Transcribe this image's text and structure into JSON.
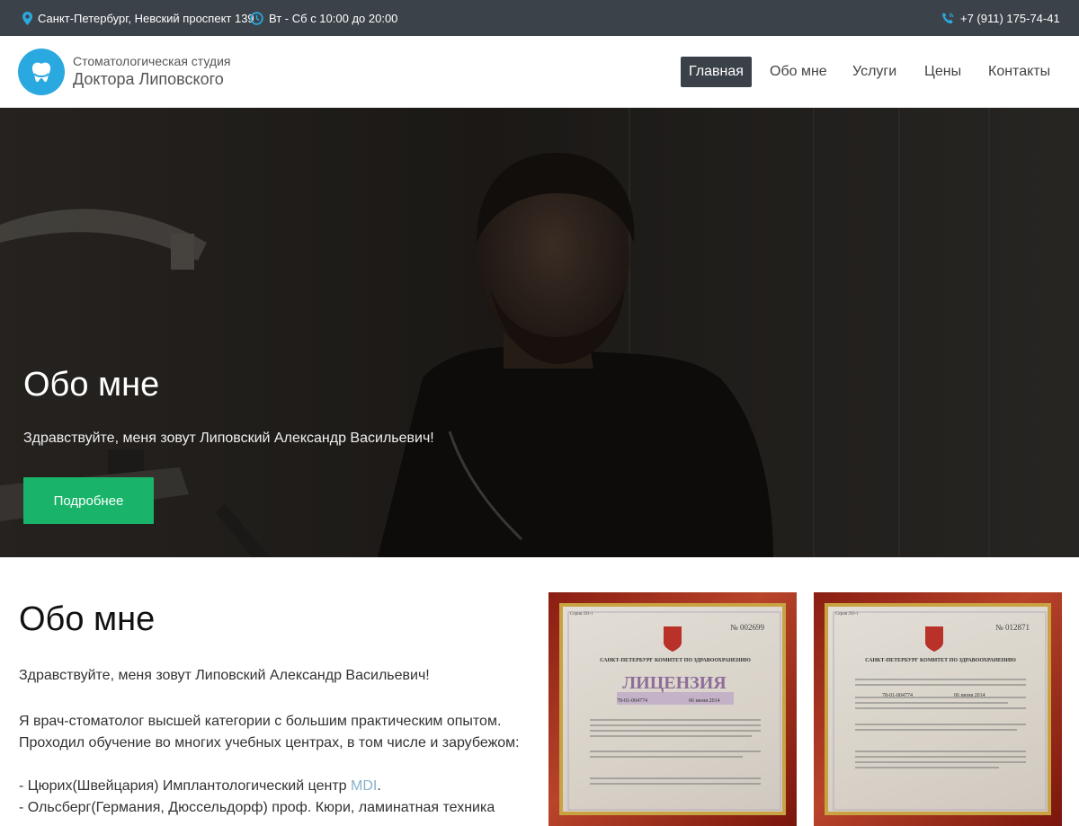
{
  "topbar": {
    "address": "Санкт-Петербург, Невский проспект 139",
    "hours": "Вт - Сб с 10:00 до 20:00",
    "phone": "+7 (911) 175-74-41"
  },
  "brand": {
    "line1": "Стоматологическая студия",
    "line2": "Доктора Липовского"
  },
  "nav": {
    "items": [
      {
        "label": "Главная",
        "active": true
      },
      {
        "label": "Обо мне"
      },
      {
        "label": "Услуги"
      },
      {
        "label": "Цены"
      },
      {
        "label": "Контакты"
      }
    ]
  },
  "hero": {
    "title": "Обо мне",
    "subtitle": "Здравствуйте, меня зовут Липовский Александр Васильевич!",
    "button": "Подробнее"
  },
  "about": {
    "title": "Обо мне",
    "greeting": "Здравствуйте, меня зовут Липовский Александр Васильевич!",
    "p1": "Я врач-стоматолог высшей категории с большим практическим опытом.",
    "p2": "Проходил обучение во многих учебных центрах, в том числе и зарубежом:",
    "list1_text": "- Цюрих(Швейцария) Имплантологический центр ",
    "list1_link": "MDI",
    "list1_end": ".",
    "list2_text": "- Ольсберг(Германия, Дюссельдорф) проф. Кюри, ламинатная техника"
  },
  "certificates": {
    "cert1": {
      "number": "№ 002699",
      "org": "САНКТ-ПЕТЕРБУРГ КОМИТЕТ ПО ЗДРАВООХРАНЕНИЮ",
      "heading": "ЛИЦЕНЗИЯ",
      "license_no": "78-01-004774",
      "date": "06 июня 2014"
    },
    "cert2": {
      "number": "№ 012871",
      "org": "САНКТ-ПЕТЕРБУРГ КОМИТЕТ ПО ЗДРАВООХРАНЕНИЮ",
      "license_no": "78-01-004774",
      "date": "06 июня 2014"
    }
  },
  "colors": {
    "topbar": "#3c4249",
    "accent_icon": "#2aa8e0",
    "button_green": "#19b46a",
    "nav_active": "#3b4148"
  }
}
